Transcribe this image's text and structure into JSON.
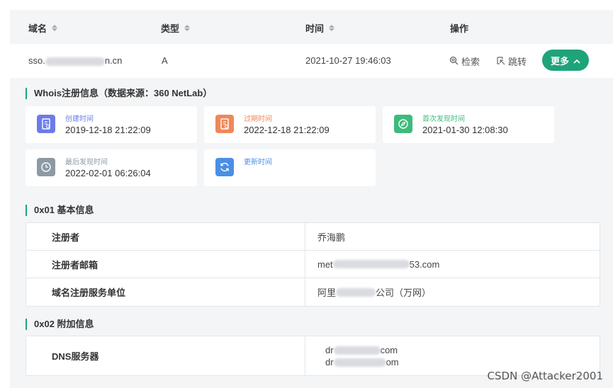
{
  "table": {
    "headers": {
      "domain": "域名",
      "type": "类型",
      "time": "时间",
      "actions": "操作"
    },
    "row": {
      "domain_prefix": "sso.",
      "domain_suffix": "n.cn",
      "type": "A",
      "time": "2021-10-27 19:46:03",
      "search_label": "检索",
      "jump_label": "跳转",
      "more_label": "更多"
    }
  },
  "whois": {
    "title": "Whois注册信息（数据来源：360 NetLab）",
    "cards": [
      {
        "label": "创建时间",
        "value": "2019-12-18 21:22:09",
        "color": "#6b7ce8",
        "icon": "document-icon"
      },
      {
        "label": "过期时间",
        "value": "2022-12-18 21:22:09",
        "color": "#f0875a",
        "icon": "document-icon"
      },
      {
        "label": "首次发现时间",
        "value": "2021-01-30 12:08:30",
        "color": "#3dbb7c",
        "icon": "compass-icon"
      },
      {
        "label": "最后发现时间",
        "value": "2022-02-01 06:26:04",
        "color": "#8c9aa6",
        "icon": "clock-icon"
      },
      {
        "label": "更新时间",
        "value": "",
        "color": "#4a8fe7",
        "icon": "refresh-icon"
      }
    ]
  },
  "basic": {
    "title": "0x01 基本信息",
    "rows": [
      {
        "key": "注册者",
        "value": "乔海鹏"
      },
      {
        "key": "注册者邮箱",
        "value_prefix": "met",
        "value_suffix": "53.com"
      },
      {
        "key": "域名注册服务单位",
        "value_prefix": "阿里",
        "value_suffix": "公司（万网）"
      }
    ]
  },
  "extra": {
    "title": "0x02 附加信息",
    "dns_key": "DNS服务器",
    "dns_values": [
      {
        "prefix": "dr",
        "suffix": "com"
      },
      {
        "prefix": "dr",
        "suffix": "om"
      }
    ]
  },
  "watermark": "CSDN @Attacker2001",
  "colors": {
    "accent": "#1fa37a",
    "panel_bg": "#f4f5f7"
  }
}
